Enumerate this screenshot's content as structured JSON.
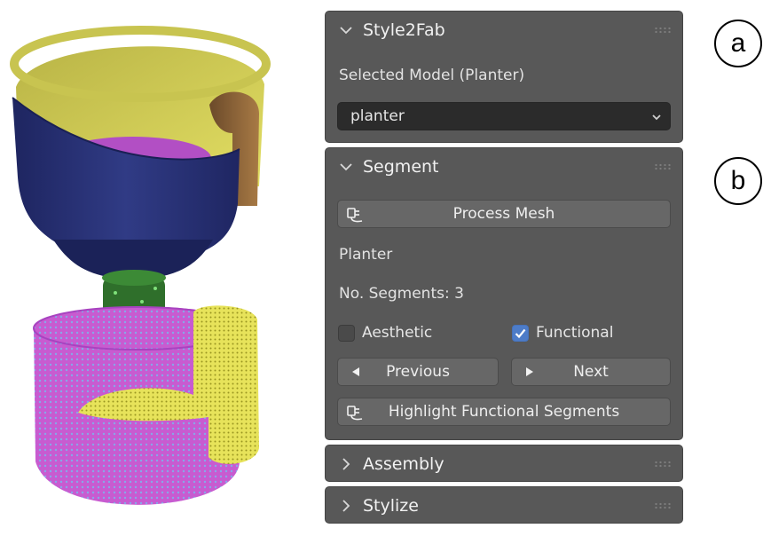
{
  "annotations": {
    "a": "a",
    "b": "b"
  },
  "panels": {
    "style2fab": {
      "title": "Style2Fab",
      "selected_label": "Selected Model (Planter)",
      "dropdown_value": "planter"
    },
    "segment": {
      "title": "Segment",
      "process_button": "Process Mesh",
      "model_name": "Planter",
      "segments_text": "No. Segments: 3",
      "aesthetic_label": "Aesthetic",
      "aesthetic_checked": false,
      "functional_label": "Functional",
      "functional_checked": true,
      "previous_button": "Previous",
      "next_button": "Next",
      "highlight_button": "Highlight Functional Segments"
    },
    "assembly": {
      "title": "Assembly"
    },
    "stylize": {
      "title": "Stylize"
    }
  },
  "colors": {
    "panel_bg": "#585858",
    "checkbox_accent": "#4d7cc8",
    "mesh_navy": "#27306e",
    "mesh_yellow": "#d8d34a",
    "mesh_magenta": "#b44ec6",
    "mesh_green": "#2e6e2a"
  },
  "icons": [
    "chevron-down-icon",
    "chevron-right-icon",
    "grip-icon",
    "plug-icon",
    "triangle-left-icon",
    "triangle-right-icon",
    "checkmark-icon",
    "dropdown-caret-icon"
  ]
}
